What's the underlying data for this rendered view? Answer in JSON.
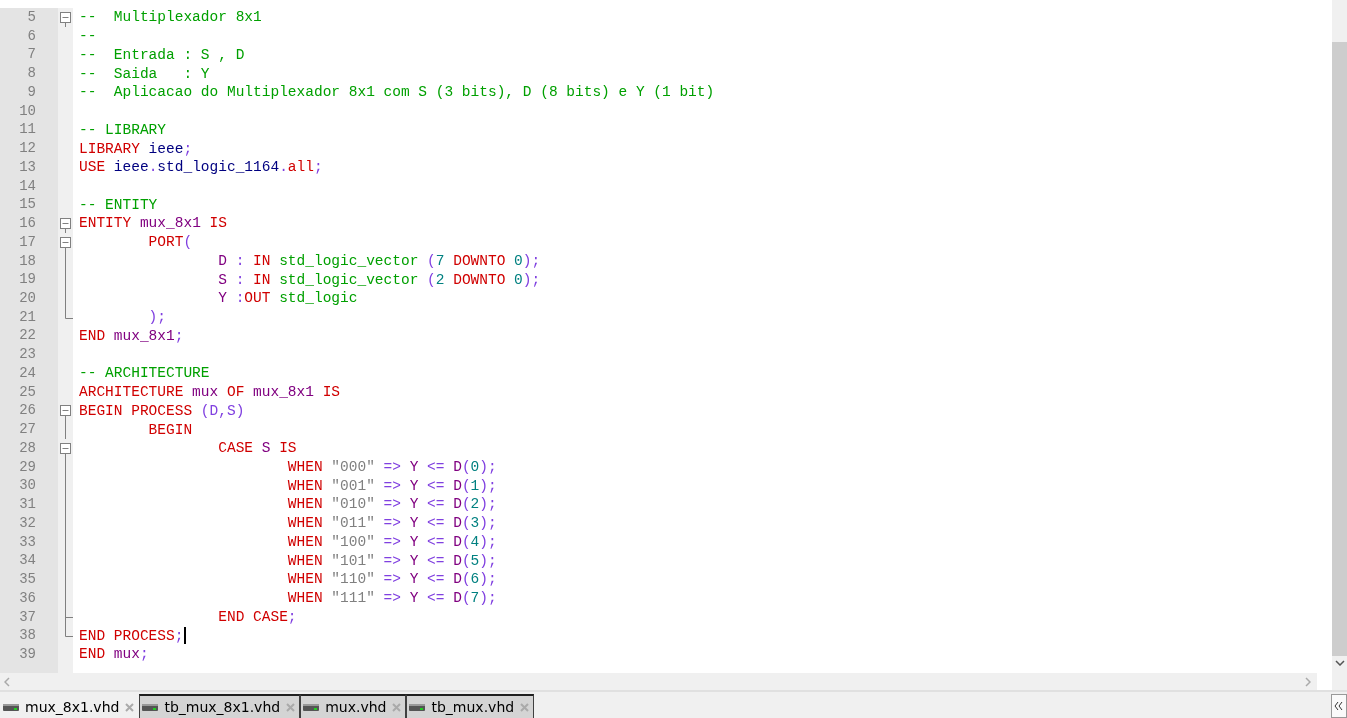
{
  "editor": {
    "lines": [
      {
        "number": "5",
        "fold": {
          "kind": "box"
        },
        "cursor": false,
        "tokens": [
          {
            "text": "--  Multiplexador 8x1",
            "kind": "comment"
          }
        ]
      },
      {
        "number": "6",
        "cursor": false,
        "tokens": [
          {
            "text": "--",
            "kind": "comment"
          }
        ]
      },
      {
        "number": "7",
        "cursor": false,
        "tokens": [
          {
            "text": "--  Entrada : S , D",
            "kind": "comment"
          }
        ]
      },
      {
        "number": "8",
        "cursor": false,
        "tokens": [
          {
            "text": "--  Saida   : Y",
            "kind": "comment"
          }
        ]
      },
      {
        "number": "9",
        "cursor": false,
        "tokens": [
          {
            "text": "--  Aplicacao do Multiplexador 8x1 com S (3 bits), D (8 bits) e Y (1 bit)",
            "kind": "comment"
          }
        ]
      },
      {
        "number": "10",
        "cursor": false
      },
      {
        "number": "11",
        "cursor": false,
        "tokens": [
          {
            "text": "-- LIBRARY",
            "kind": "comment"
          }
        ]
      },
      {
        "number": "12",
        "cursor": false,
        "tokens": [
          {
            "text": "LIBRARY",
            "kind": "keyword"
          },
          {
            "text": " ieee",
            "kind": "library"
          },
          {
            "text": ";",
            "kind": "operator"
          }
        ]
      },
      {
        "number": "13",
        "cursor": false,
        "tokens": [
          {
            "text": "USE",
            "kind": "keyword"
          },
          {
            "text": " ieee",
            "kind": "library"
          },
          {
            "text": ".",
            "kind": "operator"
          },
          {
            "text": "std_logic_1164",
            "kind": "library"
          },
          {
            "text": ".",
            "kind": "operator"
          },
          {
            "text": "all",
            "kind": "keyword"
          },
          {
            "text": ";",
            "kind": "operator"
          }
        ]
      },
      {
        "number": "14",
        "cursor": false
      },
      {
        "number": "15",
        "cursor": false,
        "tokens": [
          {
            "text": "-- ENTITY",
            "kind": "comment"
          }
        ]
      },
      {
        "number": "16",
        "fold": {
          "kind": "box"
        },
        "cursor": false,
        "tokens": [
          {
            "text": "ENTITY",
            "kind": "keyword"
          },
          {
            "text": " mux_8x1",
            "kind": "identifier"
          },
          {
            "text": " IS",
            "kind": "keyword"
          }
        ]
      },
      {
        "number": "17",
        "fold": {
          "kind": "box"
        },
        "cursor": false,
        "tokens": [
          {
            "text": "        PORT",
            "kind": "keyword"
          },
          {
            "text": "(",
            "kind": "operator"
          }
        ]
      },
      {
        "number": "18",
        "fold": {
          "kind": "line"
        },
        "cursor": false,
        "tokens": [
          {
            "text": "                D",
            "kind": "identifier"
          },
          {
            "text": " :",
            "kind": "operator"
          },
          {
            "text": " IN",
            "kind": "keyword"
          },
          {
            "text": " std_logic_vector",
            "kind": "type"
          },
          {
            "text": " (",
            "kind": "operator"
          },
          {
            "text": "7",
            "kind": "number"
          },
          {
            "text": " DOWNTO",
            "kind": "keyword"
          },
          {
            "text": " 0",
            "kind": "number"
          },
          {
            "text": ");",
            "kind": "operator"
          }
        ]
      },
      {
        "number": "19",
        "fold": {
          "kind": "line"
        },
        "cursor": false,
        "tokens": [
          {
            "text": "                S",
            "kind": "identifier"
          },
          {
            "text": " :",
            "kind": "operator"
          },
          {
            "text": " IN",
            "kind": "keyword"
          },
          {
            "text": " std_logic_vector",
            "kind": "type"
          },
          {
            "text": " (",
            "kind": "operator"
          },
          {
            "text": "2",
            "kind": "number"
          },
          {
            "text": " DOWNTO",
            "kind": "keyword"
          },
          {
            "text": " 0",
            "kind": "number"
          },
          {
            "text": ");",
            "kind": "operator"
          }
        ]
      },
      {
        "number": "20",
        "fold": {
          "kind": "line"
        },
        "cursor": false,
        "tokens": [
          {
            "text": "                Y",
            "kind": "identifier"
          },
          {
            "text": " :",
            "kind": "operator"
          },
          {
            "text": "OUT",
            "kind": "keyword"
          },
          {
            "text": " std_logic",
            "kind": "type"
          }
        ]
      },
      {
        "number": "21",
        "fold": {
          "kind": "end"
        },
        "cursor": false,
        "tokens": [
          {
            "text": "        );",
            "kind": "operator"
          }
        ]
      },
      {
        "number": "22",
        "cursor": false,
        "tokens": [
          {
            "text": "END",
            "kind": "keyword"
          },
          {
            "text": " mux_8x1",
            "kind": "identifier"
          },
          {
            "text": ";",
            "kind": "operator"
          }
        ]
      },
      {
        "number": "23",
        "cursor": false
      },
      {
        "number": "24",
        "cursor": false,
        "tokens": [
          {
            "text": "-- ARCHITECTURE",
            "kind": "comment"
          }
        ]
      },
      {
        "number": "25",
        "cursor": false,
        "tokens": [
          {
            "text": "ARCHITECTURE",
            "kind": "keyword"
          },
          {
            "text": " mux",
            "kind": "identifier"
          },
          {
            "text": " OF",
            "kind": "keyword"
          },
          {
            "text": " mux_8x1",
            "kind": "identifier"
          },
          {
            "text": " IS",
            "kind": "keyword"
          }
        ]
      },
      {
        "number": "26",
        "fold": {
          "kind": "box"
        },
        "cursor": false,
        "tokens": [
          {
            "text": "BEGIN PROCESS",
            "kind": "keyword"
          },
          {
            "text": " (D,S)",
            "kind": "operator"
          }
        ]
      },
      {
        "number": "27",
        "fold": {
          "kind": "line"
        },
        "cursor": false,
        "tokens": [
          {
            "text": "        BEGIN",
            "kind": "keyword"
          }
        ]
      },
      {
        "number": "28",
        "fold": {
          "kind": "box"
        },
        "cursor": false,
        "tokens": [
          {
            "text": "                CASE",
            "kind": "keyword"
          },
          {
            "text": " S",
            "kind": "identifier"
          },
          {
            "text": " IS",
            "kind": "keyword"
          }
        ]
      },
      {
        "number": "29",
        "fold": {
          "kind": "line"
        },
        "cursor": false,
        "tokens": [
          {
            "text": "                        WHEN",
            "kind": "keyword"
          },
          {
            "text": " \"000\"",
            "kind": "string"
          },
          {
            "text": " =>",
            "kind": "operator"
          },
          {
            "text": " Y",
            "kind": "identifier"
          },
          {
            "text": " <=",
            "kind": "operator"
          },
          {
            "text": " D",
            "kind": "identifier"
          },
          {
            "text": "(",
            "kind": "operator"
          },
          {
            "text": "0",
            "kind": "number"
          },
          {
            "text": ");",
            "kind": "operator"
          }
        ]
      },
      {
        "number": "30",
        "fold": {
          "kind": "line"
        },
        "cursor": false,
        "tokens": [
          {
            "text": "                        WHEN",
            "kind": "keyword"
          },
          {
            "text": " \"001\"",
            "kind": "string"
          },
          {
            "text": " =>",
            "kind": "operator"
          },
          {
            "text": " Y",
            "kind": "identifier"
          },
          {
            "text": " <=",
            "kind": "operator"
          },
          {
            "text": " D",
            "kind": "identifier"
          },
          {
            "text": "(",
            "kind": "operator"
          },
          {
            "text": "1",
            "kind": "number"
          },
          {
            "text": ");",
            "kind": "operator"
          }
        ]
      },
      {
        "number": "31",
        "fold": {
          "kind": "line"
        },
        "cursor": false,
        "tokens": [
          {
            "text": "                        WHEN",
            "kind": "keyword"
          },
          {
            "text": " \"010\"",
            "kind": "string"
          },
          {
            "text": " =>",
            "kind": "operator"
          },
          {
            "text": " Y",
            "kind": "identifier"
          },
          {
            "text": " <=",
            "kind": "operator"
          },
          {
            "text": " D",
            "kind": "identifier"
          },
          {
            "text": "(",
            "kind": "operator"
          },
          {
            "text": "2",
            "kind": "number"
          },
          {
            "text": ");",
            "kind": "operator"
          }
        ]
      },
      {
        "number": "32",
        "fold": {
          "kind": "line"
        },
        "cursor": false,
        "tokens": [
          {
            "text": "                        WHEN",
            "kind": "keyword"
          },
          {
            "text": " \"011\"",
            "kind": "string"
          },
          {
            "text": " =>",
            "kind": "operator"
          },
          {
            "text": " Y",
            "kind": "identifier"
          },
          {
            "text": " <=",
            "kind": "operator"
          },
          {
            "text": " D",
            "kind": "identifier"
          },
          {
            "text": "(",
            "kind": "operator"
          },
          {
            "text": "3",
            "kind": "number"
          },
          {
            "text": ");",
            "kind": "operator"
          }
        ]
      },
      {
        "number": "33",
        "fold": {
          "kind": "line"
        },
        "cursor": false,
        "tokens": [
          {
            "text": "                        WHEN",
            "kind": "keyword"
          },
          {
            "text": " \"100\"",
            "kind": "string"
          },
          {
            "text": " =>",
            "kind": "operator"
          },
          {
            "text": " Y",
            "kind": "identifier"
          },
          {
            "text": " <=",
            "kind": "operator"
          },
          {
            "text": " D",
            "kind": "identifier"
          },
          {
            "text": "(",
            "kind": "operator"
          },
          {
            "text": "4",
            "kind": "number"
          },
          {
            "text": ");",
            "kind": "operator"
          }
        ]
      },
      {
        "number": "34",
        "fold": {
          "kind": "line"
        },
        "cursor": false,
        "tokens": [
          {
            "text": "                        WHEN",
            "kind": "keyword"
          },
          {
            "text": " \"101\"",
            "kind": "string"
          },
          {
            "text": " =>",
            "kind": "operator"
          },
          {
            "text": " Y",
            "kind": "identifier"
          },
          {
            "text": " <=",
            "kind": "operator"
          },
          {
            "text": " D",
            "kind": "identifier"
          },
          {
            "text": "(",
            "kind": "operator"
          },
          {
            "text": "5",
            "kind": "number"
          },
          {
            "text": ");",
            "kind": "operator"
          }
        ]
      },
      {
        "number": "35",
        "fold": {
          "kind": "line"
        },
        "cursor": false,
        "tokens": [
          {
            "text": "                        WHEN",
            "kind": "keyword"
          },
          {
            "text": " \"110\"",
            "kind": "string"
          },
          {
            "text": " =>",
            "kind": "operator"
          },
          {
            "text": " Y",
            "kind": "identifier"
          },
          {
            "text": " <=",
            "kind": "operator"
          },
          {
            "text": " D",
            "kind": "identifier"
          },
          {
            "text": "(",
            "kind": "operator"
          },
          {
            "text": "6",
            "kind": "number"
          },
          {
            "text": ");",
            "kind": "operator"
          }
        ]
      },
      {
        "number": "36",
        "fold": {
          "kind": "line"
        },
        "cursor": false,
        "tokens": [
          {
            "text": "                        WHEN",
            "kind": "keyword"
          },
          {
            "text": " \"111\"",
            "kind": "string"
          },
          {
            "text": " =>",
            "kind": "operator"
          },
          {
            "text": " Y",
            "kind": "identifier"
          },
          {
            "text": " <=",
            "kind": "operator"
          },
          {
            "text": " D",
            "kind": "identifier"
          },
          {
            "text": "(",
            "kind": "operator"
          },
          {
            "text": "7",
            "kind": "number"
          },
          {
            "text": ");",
            "kind": "operator"
          }
        ]
      },
      {
        "number": "37",
        "fold": {
          "kind": "tee"
        },
        "cursor": false,
        "tokens": [
          {
            "text": "                END CASE",
            "kind": "keyword"
          },
          {
            "text": ";",
            "kind": "operator"
          }
        ]
      },
      {
        "number": "38",
        "fold": {
          "kind": "end"
        },
        "cursor": true,
        "tokens": [
          {
            "text": "END PROCESS",
            "kind": "keyword"
          },
          {
            "text": ";",
            "kind": "operator"
          }
        ]
      },
      {
        "number": "39",
        "cursor": false,
        "tokens": [
          {
            "text": "END",
            "kind": "keyword"
          },
          {
            "text": " mux",
            "kind": "identifier"
          },
          {
            "text": ";",
            "kind": "operator"
          }
        ]
      }
    ]
  },
  "tabs": [
    {
      "label": "mux_8x1.vhd",
      "selected": true
    },
    {
      "label": "tb_mux_8x1.vhd",
      "selected": false
    },
    {
      "label": "mux.vhd",
      "selected": false
    },
    {
      "label": "tb_mux.vhd",
      "selected": false
    }
  ]
}
